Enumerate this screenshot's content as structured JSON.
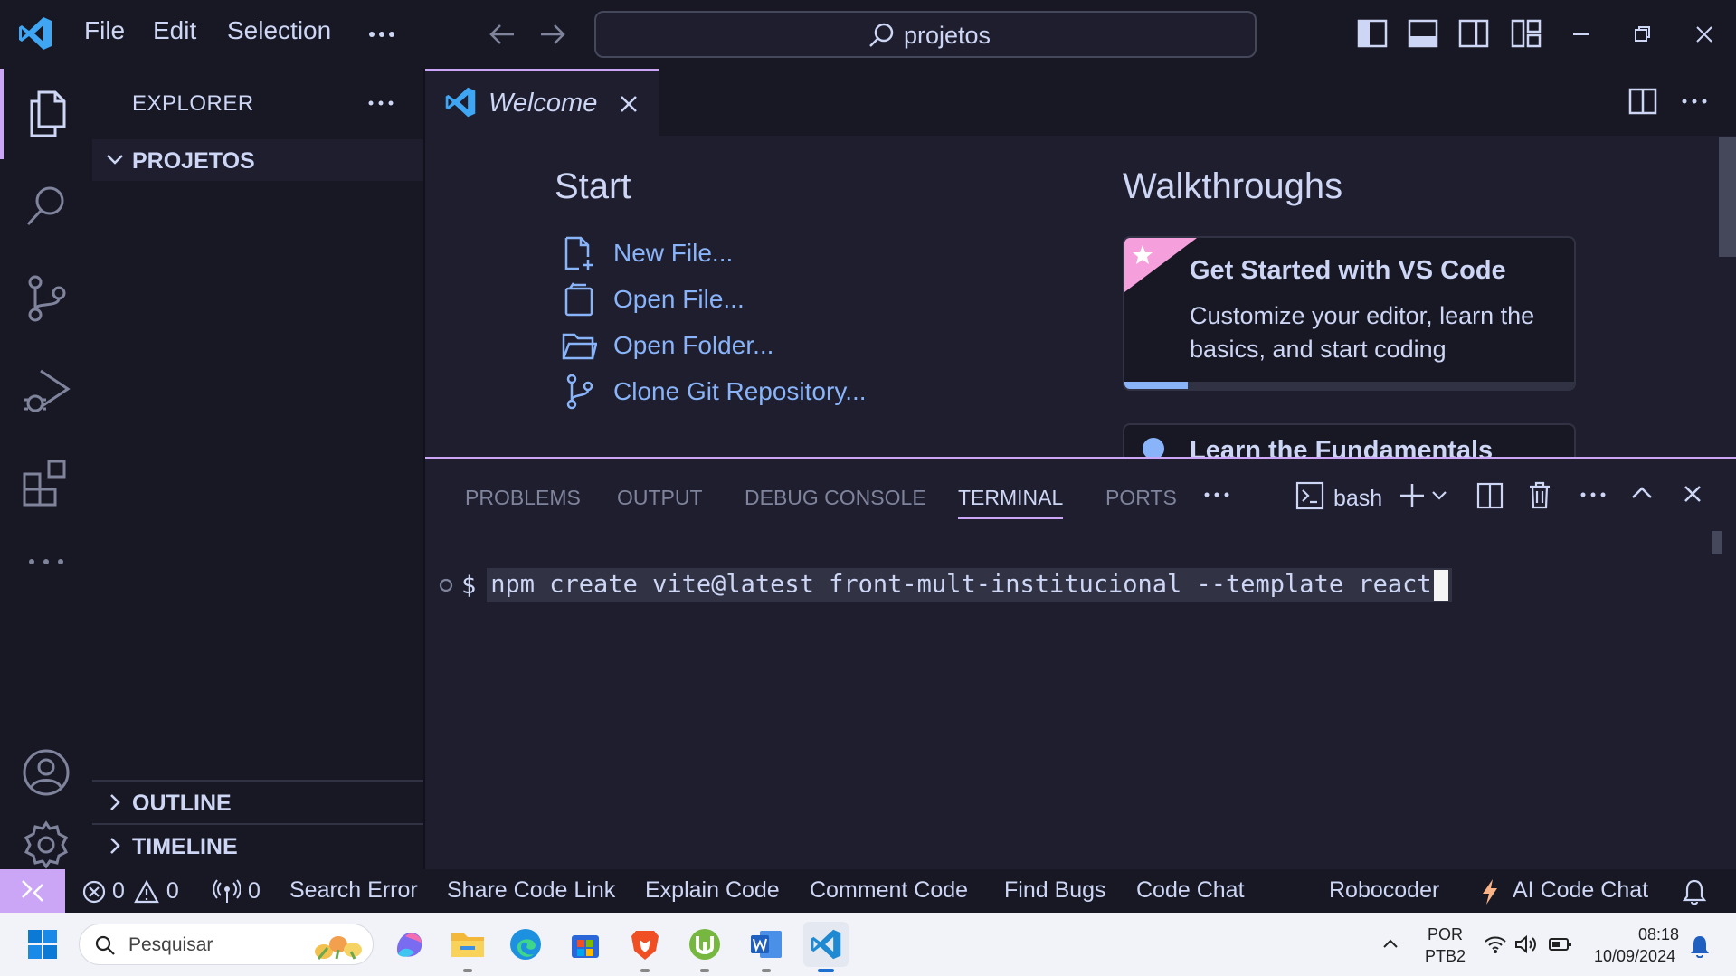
{
  "titlebar": {
    "menu": [
      "File",
      "Edit",
      "Selection"
    ],
    "search_text": "projetos"
  },
  "sidebar": {
    "title": "EXPLORER",
    "folder": "PROJETOS",
    "outline": "OUTLINE",
    "timeline": "TIMELINE"
  },
  "editor": {
    "tab_label": "Welcome",
    "start_heading": "Start",
    "start_links": [
      "New File...",
      "Open File...",
      "Open Folder...",
      "Clone Git Repository..."
    ],
    "walkthroughs_heading": "Walkthroughs",
    "card1": {
      "title": "Get Started with VS Code",
      "description": "Customize your editor, learn the basics, and start coding",
      "progress": 0.14
    },
    "card2": {
      "title": "Learn the Fundamentals"
    }
  },
  "panel": {
    "tabs": [
      "PROBLEMS",
      "OUTPUT",
      "DEBUG CONSOLE",
      "TERMINAL",
      "PORTS"
    ],
    "active_tab": "TERMINAL",
    "terminal_name": "bash",
    "prompt": "$",
    "command": "npm create vite@latest front-mult-institucional --template react"
  },
  "statusbar": {
    "errors": "0",
    "warnings": "0",
    "ports": "0",
    "items": [
      "Search Error",
      "Share Code Link",
      "Explain Code",
      "Comment Code",
      "Find Bugs",
      "Code Chat"
    ],
    "robocoder": "Robocoder",
    "ai_chat": "AI Code Chat"
  },
  "taskbar": {
    "search_placeholder": "Pesquisar",
    "lang_1": "POR",
    "lang_2": "PTB2",
    "time": "08:18",
    "date": "10/09/2024"
  },
  "colors": {
    "accent": "#cba6f7",
    "link": "#89b4fa",
    "card_badge": "#f5a0dc"
  }
}
